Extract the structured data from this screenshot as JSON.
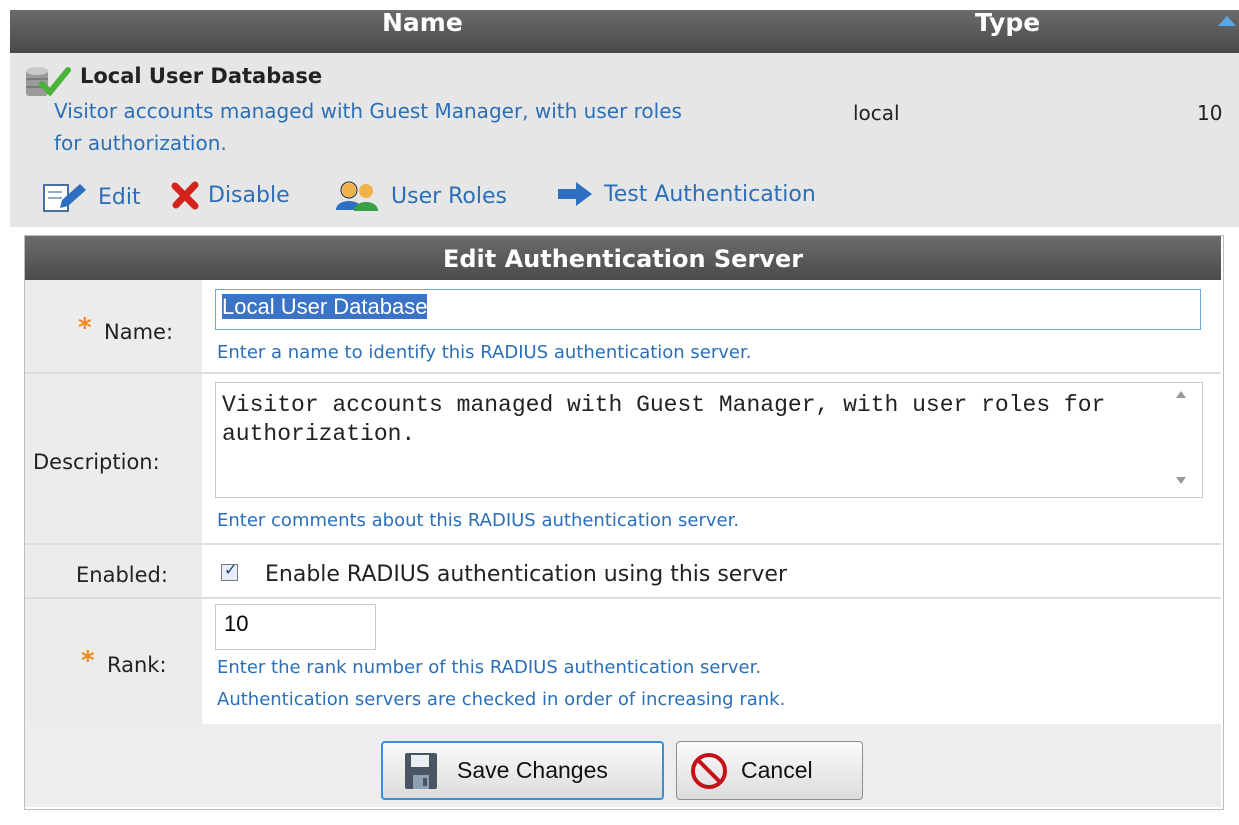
{
  "table": {
    "columns": {
      "name": "Name",
      "type": "Type"
    },
    "row": {
      "title": "Local User Database",
      "description_line1": "Visitor accounts managed with Guest Manager, with user roles",
      "description_line2": "for authorization.",
      "type": "local",
      "rank": "10"
    }
  },
  "actions": [
    {
      "label": "Edit",
      "icon": "edit-icon"
    },
    {
      "label": "Disable",
      "icon": "disable-icon"
    },
    {
      "label": "User Roles",
      "icon": "user-roles-icon"
    },
    {
      "label": "Test Authentication",
      "icon": "arrow-right-icon"
    }
  ],
  "form": {
    "title": "Edit Authentication Server",
    "name": {
      "label": "Name:",
      "value": "Local User Database",
      "hint": "Enter a name to identify this RADIUS authentication server."
    },
    "description": {
      "label": "Description:",
      "value": "Visitor accounts managed with Guest Manager, with user roles for authorization.",
      "hint": "Enter comments about this RADIUS authentication server."
    },
    "enabled": {
      "label": "Enabled:",
      "checked": true,
      "text": "Enable RADIUS authentication using this server"
    },
    "rank": {
      "label": "Rank:",
      "value": "10",
      "hint_line1": "Enter the rank number of this RADIUS authentication server.",
      "hint_line2": "Authentication servers are checked in order of increasing rank."
    },
    "required_marker": "*",
    "buttons": {
      "save": "Save Changes",
      "cancel": "Cancel"
    }
  },
  "colors": {
    "header_bg": "#555555",
    "link": "#2a6fb8",
    "required": "#f08a1c",
    "selection": "#3b74c7"
  }
}
